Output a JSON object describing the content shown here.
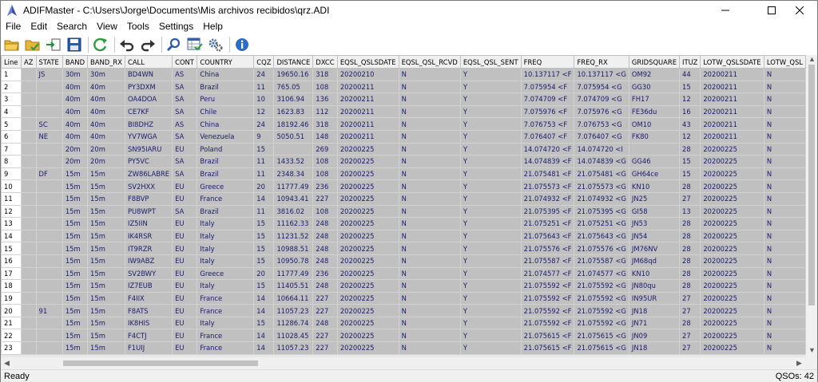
{
  "window": {
    "title": "ADIFMaster - C:\\Users\\Jorge\\Documents\\Mis archivos recibidos\\qrz.ADI"
  },
  "menu": [
    "File",
    "Edit",
    "Search",
    "View",
    "Tools",
    "Settings",
    "Help"
  ],
  "toolbar_icons": [
    "open-folder-icon",
    "open-recent-icon",
    "import-icon",
    "save-icon",
    "refresh-icon",
    "undo-icon",
    "redo-icon",
    "search-icon",
    "table-check-icon",
    "settings-gears-icon",
    "info-icon"
  ],
  "columns": [
    "Line",
    "AZ",
    "STATE",
    "BAND",
    "BAND_RX",
    "CALL",
    "CONT",
    "COUNTRY",
    "CQZ",
    "DISTANCE",
    "DXCC",
    "EQSL_QSLSDATE",
    "EQSL_QSL_RCVD",
    "EQSL_QSL_SENT",
    "FREQ",
    "FREQ_RX",
    "GRIDSQUARE",
    "ITUZ",
    "LOTW_QSLSDATE",
    "LOTW_QSL"
  ],
  "rows": [
    [
      "1",
      "",
      "JS",
      "30m",
      "30m",
      "BD4WN",
      "AS",
      "China",
      "24",
      "19650.16",
      "318",
      "20200210",
      "N",
      "Y",
      "10.137117 <F",
      "10.137117 <G",
      "OM92",
      "44",
      "20200211",
      "N"
    ],
    [
      "2",
      "",
      "",
      "40m",
      "40m",
      "PY3DXM",
      "SA",
      "Brazil",
      "11",
      "765.05",
      "108",
      "20200211",
      "N",
      "Y",
      "7.075954 <F",
      "7.075954 <G",
      "GG30",
      "15",
      "20200211",
      "N"
    ],
    [
      "3",
      "",
      "",
      "40m",
      "40m",
      "OA4DOA",
      "SA",
      "Peru",
      "10",
      "3106.94",
      "136",
      "20200211",
      "N",
      "Y",
      "7.074709 <F",
      "7.074709 <G",
      "FH17",
      "12",
      "20200211",
      "N"
    ],
    [
      "4",
      "",
      "",
      "40m",
      "40m",
      "CE7KF",
      "SA",
      "Chile",
      "12",
      "1623.83",
      "112",
      "20200211",
      "N",
      "Y",
      "7.075976 <F",
      "7.075976 <G",
      "FE36du",
      "16",
      "20200211",
      "N"
    ],
    [
      "5",
      "",
      "SC",
      "40m",
      "40m",
      "BI8DHZ",
      "AS",
      "China",
      "24",
      "18192.46",
      "318",
      "20200211",
      "N",
      "Y",
      "7.076753 <F",
      "7.076753 <G",
      "OM10",
      "43",
      "20200211",
      "N"
    ],
    [
      "6",
      "",
      "NE",
      "40m",
      "40m",
      "YV7WGA",
      "SA",
      "Venezuela",
      "9",
      "5050.51",
      "148",
      "20200211",
      "N",
      "Y",
      "7.076407 <F",
      "7.076407 <G",
      "FK80",
      "12",
      "20200211",
      "N"
    ],
    [
      "7",
      "",
      "",
      "20m",
      "20m",
      "SN95IARU",
      "EU",
      "Poland",
      "15",
      "",
      "269",
      "20200225",
      "N",
      "Y",
      "14.074720 <F",
      "14.074720 <I",
      "",
      "28",
      "20200225",
      "N"
    ],
    [
      "8",
      "",
      "",
      "20m",
      "20m",
      "PY5VC",
      "SA",
      "Brazil",
      "11",
      "1433.52",
      "108",
      "20200225",
      "N",
      "Y",
      "14.074839 <F",
      "14.074839 <G",
      "GG46",
      "15",
      "20200225",
      "N"
    ],
    [
      "9",
      "",
      "DF",
      "15m",
      "15m",
      "ZW86LABRE",
      "SA",
      "Brazil",
      "11",
      "2348.34",
      "108",
      "20200225",
      "N",
      "Y",
      "21.075481 <F",
      "21.075481 <G",
      "GH64ce",
      "15",
      "20200225",
      "N"
    ],
    [
      "10",
      "",
      "",
      "15m",
      "15m",
      "SV2HXX",
      "EU",
      "Greece",
      "20",
      "11777.49",
      "236",
      "20200225",
      "N",
      "Y",
      "21.075573 <F",
      "21.075573 <G",
      "KN10",
      "28",
      "20200225",
      "N"
    ],
    [
      "11",
      "",
      "",
      "15m",
      "15m",
      "F8BVP",
      "EU",
      "France",
      "14",
      "10943.41",
      "227",
      "20200225",
      "N",
      "Y",
      "21.074932 <F",
      "21.074932 <G",
      "JN25",
      "27",
      "20200225",
      "N"
    ],
    [
      "12",
      "",
      "",
      "15m",
      "15m",
      "PU8WPT",
      "SA",
      "Brazil",
      "11",
      "3816.02",
      "108",
      "20200225",
      "N",
      "Y",
      "21.075395 <F",
      "21.075395 <G",
      "GI58",
      "13",
      "20200225",
      "N"
    ],
    [
      "13",
      "",
      "",
      "15m",
      "15m",
      "IZ5IIN",
      "EU",
      "Italy",
      "15",
      "11162.33",
      "248",
      "20200225",
      "N",
      "Y",
      "21.075251 <F",
      "21.075251 <G",
      "JN53",
      "28",
      "20200225",
      "N"
    ],
    [
      "14",
      "",
      "",
      "15m",
      "15m",
      "IK4RSR",
      "EU",
      "Italy",
      "15",
      "11231.52",
      "248",
      "20200225",
      "N",
      "Y",
      "21.075643 <F",
      "21.075643 <G",
      "JN54",
      "28",
      "20200225",
      "N"
    ],
    [
      "15",
      "",
      "",
      "15m",
      "15m",
      "IT9RZR",
      "EU",
      "Italy",
      "15",
      "10988.51",
      "248",
      "20200225",
      "N",
      "Y",
      "21.075576 <F",
      "21.075576 <G",
      "JM76NV",
      "28",
      "20200225",
      "N"
    ],
    [
      "16",
      "",
      "",
      "15m",
      "15m",
      "IW9ABZ",
      "EU",
      "Italy",
      "15",
      "10950.78",
      "248",
      "20200225",
      "N",
      "Y",
      "21.075587 <F",
      "21.075587 <G",
      "JM68qd",
      "28",
      "20200225",
      "N"
    ],
    [
      "17",
      "",
      "",
      "15m",
      "15m",
      "SV2BWY",
      "EU",
      "Greece",
      "20",
      "11777.49",
      "236",
      "20200225",
      "N",
      "Y",
      "21.074577 <F",
      "21.074577 <G",
      "KN10",
      "28",
      "20200225",
      "N"
    ],
    [
      "18",
      "",
      "",
      "15m",
      "15m",
      "IZ7EUB",
      "EU",
      "Italy",
      "15",
      "11405.51",
      "248",
      "20200225",
      "N",
      "Y",
      "21.075592 <F",
      "21.075592 <G",
      "JN80qu",
      "28",
      "20200225",
      "N"
    ],
    [
      "19",
      "",
      "",
      "15m",
      "15m",
      "F4IIX",
      "EU",
      "France",
      "14",
      "10664.11",
      "227",
      "20200225",
      "N",
      "Y",
      "21.075592 <F",
      "21.075592 <G",
      "IN95UR",
      "27",
      "20200225",
      "N"
    ],
    [
      "20",
      "",
      "91",
      "15m",
      "15m",
      "F8ATS",
      "EU",
      "France",
      "14",
      "11057.23",
      "227",
      "20200225",
      "N",
      "Y",
      "21.075592 <F",
      "21.075592 <G",
      "JN18",
      "27",
      "20200225",
      "N"
    ],
    [
      "21",
      "",
      "",
      "15m",
      "15m",
      "IK8HIS",
      "EU",
      "Italy",
      "15",
      "11286.74",
      "248",
      "20200225",
      "N",
      "Y",
      "21.075592 <F",
      "21.075592 <G",
      "JN71",
      "28",
      "20200225",
      "N"
    ],
    [
      "22",
      "",
      "",
      "15m",
      "15m",
      "F4CTJ",
      "EU",
      "France",
      "14",
      "11028.45",
      "227",
      "20200225",
      "N",
      "Y",
      "21.075615 <F",
      "21.075615 <G",
      "JN09",
      "27",
      "20200225",
      "N"
    ],
    [
      "23",
      "",
      "",
      "15m",
      "15m",
      "F1UIJ",
      "EU",
      "France",
      "14",
      "11057.23",
      "227",
      "20200225",
      "N",
      "Y",
      "21.075615 <F",
      "21.075615 <G",
      "JN18",
      "27",
      "20200225",
      "N"
    ]
  ],
  "status": {
    "left": "Ready",
    "right": "QSOs: 42"
  }
}
